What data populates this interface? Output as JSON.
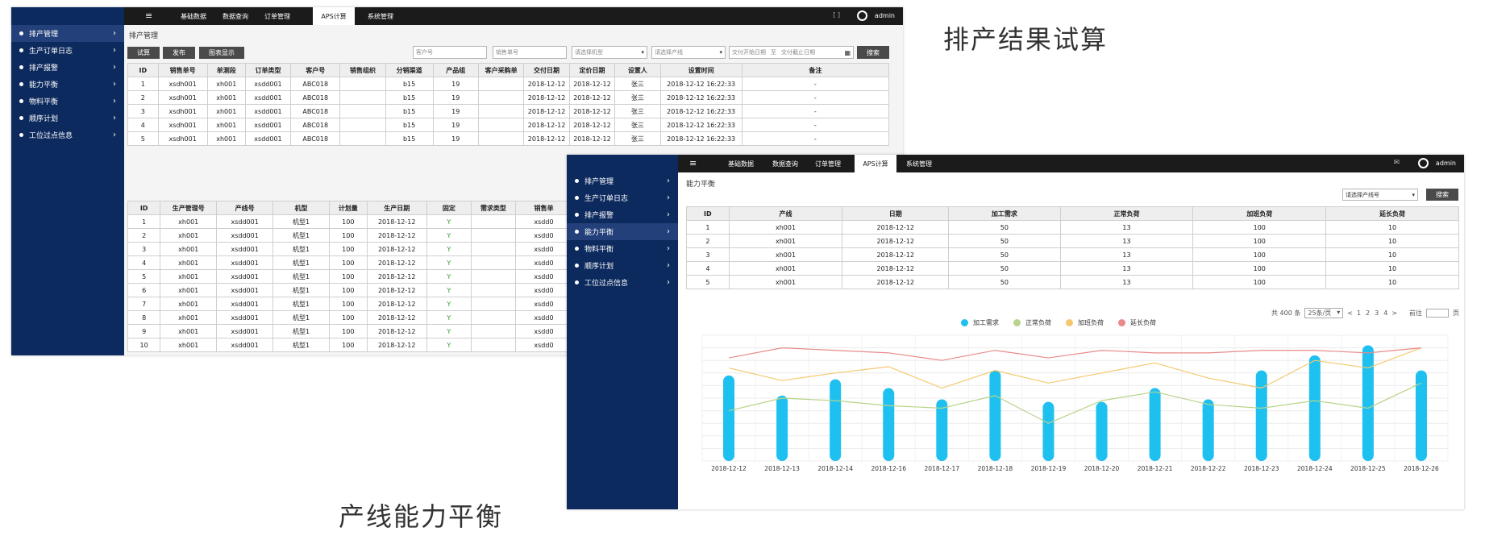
{
  "captions": {
    "top": "排产结果试算",
    "bottom": "产线能力平衡"
  },
  "win1": {
    "sidebar": [
      {
        "label": "排产管理",
        "active": true
      },
      {
        "label": "生产订单日志"
      },
      {
        "label": "排产报警"
      },
      {
        "label": "能力平衡"
      },
      {
        "label": "物料平衡"
      },
      {
        "label": "顺序计划"
      },
      {
        "label": "工位过点信息"
      }
    ],
    "menu_icon": "≡",
    "nav": [
      "基础数据",
      "数据查询",
      "订单管理",
      "APS计算",
      "系统管理"
    ],
    "active_nav": 3,
    "user": "admin",
    "section_title": "排产管理",
    "buttons": {
      "trial": "试算",
      "publish": "发布",
      "chart": "图表显示",
      "search": "搜索"
    },
    "placeholders": {
      "customer": "客户号",
      "sales": "销售单号",
      "model": "请选择机型",
      "line": "请选择产线",
      "start": "交付开始日期",
      "to": "至",
      "end": "交付截止日期"
    },
    "table1": {
      "headers": [
        "ID",
        "销售单号",
        "单测段",
        "订单类型",
        "客户号",
        "销售组织",
        "分销渠道",
        "产品组",
        "客户采购单",
        "交付日期",
        "定价日期",
        "设置人",
        "设置时间",
        "备注"
      ],
      "rows": [
        [
          "1",
          "xsdh001",
          "xh001",
          "xsdd001",
          "ABC018",
          "",
          "b15",
          "19",
          "",
          "2018-12-12",
          "2018-12-12",
          "张三",
          "2018-12-12 16:22:33",
          "-"
        ],
        [
          "2",
          "xsdh001",
          "xh001",
          "xsdd001",
          "ABC018",
          "",
          "b15",
          "19",
          "",
          "2018-12-12",
          "2018-12-12",
          "张三",
          "2018-12-12 16:22:33",
          "-"
        ],
        [
          "3",
          "xsdh001",
          "xh001",
          "xsdd001",
          "ABC018",
          "",
          "b15",
          "19",
          "",
          "2018-12-12",
          "2018-12-12",
          "张三",
          "2018-12-12 16:22:33",
          "-"
        ],
        [
          "4",
          "xsdh001",
          "xh001",
          "xsdd001",
          "ABC018",
          "",
          "b15",
          "19",
          "",
          "2018-12-12",
          "2018-12-12",
          "张三",
          "2018-12-12 16:22:33",
          "-"
        ],
        [
          "5",
          "xsdh001",
          "xh001",
          "xsdd001",
          "ABC018",
          "",
          "b15",
          "19",
          "",
          "2018-12-12",
          "2018-12-12",
          "张三",
          "2018-12-12 16:22:33",
          "-"
        ]
      ]
    },
    "table2": {
      "headers": [
        "ID",
        "生产管理号",
        "产线号",
        "机型",
        "计划量",
        "生产日期",
        "固定",
        "需求类型",
        "销售单"
      ],
      "rows": [
        [
          "1",
          "xh001",
          "xsdd001",
          "机型1",
          "100",
          "2018-12-12",
          "Y",
          "",
          "xsdd0"
        ],
        [
          "2",
          "xh001",
          "xsdd001",
          "机型1",
          "100",
          "2018-12-12",
          "Y",
          "",
          "xsdd0"
        ],
        [
          "3",
          "xh001",
          "xsdd001",
          "机型1",
          "100",
          "2018-12-12",
          "Y",
          "",
          "xsdd0"
        ],
        [
          "4",
          "xh001",
          "xsdd001",
          "机型1",
          "100",
          "2018-12-12",
          "Y",
          "",
          "xsdd0"
        ],
        [
          "5",
          "xh001",
          "xsdd001",
          "机型1",
          "100",
          "2018-12-12",
          "Y",
          "",
          "xsdd0"
        ],
        [
          "6",
          "xh001",
          "xsdd001",
          "机型1",
          "100",
          "2018-12-12",
          "Y",
          "",
          "xsdd0"
        ],
        [
          "7",
          "xh001",
          "xsdd001",
          "机型1",
          "100",
          "2018-12-12",
          "Y",
          "",
          "xsdd0"
        ],
        [
          "8",
          "xh001",
          "xsdd001",
          "机型1",
          "100",
          "2018-12-12",
          "Y",
          "",
          "xsdd0"
        ],
        [
          "9",
          "xh001",
          "xsdd001",
          "机型1",
          "100",
          "2018-12-12",
          "Y",
          "",
          "xsdd0"
        ],
        [
          "10",
          "xh001",
          "xsdd001",
          "机型1",
          "100",
          "2018-12-12",
          "Y",
          "",
          "xsdd0"
        ]
      ]
    }
  },
  "win2": {
    "sidebar": [
      {
        "label": "排产管理"
      },
      {
        "label": "生产订单日志"
      },
      {
        "label": "排产报警"
      },
      {
        "label": "能力平衡",
        "active": true
      },
      {
        "label": "物料平衡"
      },
      {
        "label": "顺序计划"
      },
      {
        "label": "工位过点信息"
      }
    ],
    "menu_icon": "≡",
    "nav": [
      "基础数据",
      "数据查询",
      "订单管理",
      "APS计算",
      "系统管理"
    ],
    "active_nav": 3,
    "user": "admin",
    "section_title": "能力平衡",
    "select_line": "请选择产线号",
    "search": "搜索",
    "table": {
      "headers": [
        "ID",
        "产线",
        "日期",
        "加工需求",
        "正常负荷",
        "加班负荷",
        "延长负荷"
      ],
      "rows": [
        [
          "1",
          "xh001",
          "2018-12-12",
          "50",
          "13",
          "100",
          "10"
        ],
        [
          "2",
          "xh001",
          "2018-12-12",
          "50",
          "13",
          "100",
          "10"
        ],
        [
          "3",
          "xh001",
          "2018-12-12",
          "50",
          "13",
          "100",
          "10"
        ],
        [
          "4",
          "xh001",
          "2018-12-12",
          "50",
          "13",
          "100",
          "10"
        ],
        [
          "5",
          "xh001",
          "2018-12-12",
          "50",
          "13",
          "100",
          "10"
        ]
      ]
    },
    "pager": {
      "total": "共 400 条",
      "page_size": "25条/页",
      "prev": "<",
      "pages": [
        "1",
        "2",
        "3",
        "4"
      ],
      "next": ">",
      "goto": "前往",
      "page_unit": "页"
    }
  },
  "chart_data": {
    "type": "bar",
    "categories": [
      "2018-12-12",
      "2018-12-13",
      "2018-12-14",
      "2018-12-16",
      "2018-12-17",
      "2018-12-18",
      "2018-12-19",
      "2018-12-20",
      "2018-12-21",
      "2018-12-22",
      "2018-12-23",
      "2018-12-24",
      "2018-12-25",
      "2018-12-26"
    ],
    "ylim": [
      0,
      100
    ],
    "grid": true,
    "legend_position": "top-center",
    "series": [
      {
        "name": "加工需求",
        "type": "bar",
        "color": "#1ec0f0",
        "values": [
          68,
          52,
          65,
          58,
          49,
          72,
          47,
          47,
          58,
          49,
          72,
          84,
          92,
          72
        ]
      },
      {
        "name": "正常负荷",
        "type": "line",
        "color": "#b8d48a",
        "values": [
          40,
          50,
          48,
          44,
          42,
          52,
          30,
          48,
          55,
          45,
          42,
          48,
          42,
          62
        ]
      },
      {
        "name": "加班负荷",
        "type": "line",
        "color": "#f3c96e",
        "values": [
          74,
          64,
          70,
          75,
          58,
          72,
          62,
          70,
          78,
          66,
          58,
          80,
          74,
          90
        ]
      },
      {
        "name": "延长负荷",
        "type": "line",
        "color": "#e98a8a",
        "values": [
          82,
          90,
          88,
          86,
          80,
          88,
          82,
          88,
          86,
          86,
          88,
          88,
          86,
          90
        ]
      }
    ]
  }
}
